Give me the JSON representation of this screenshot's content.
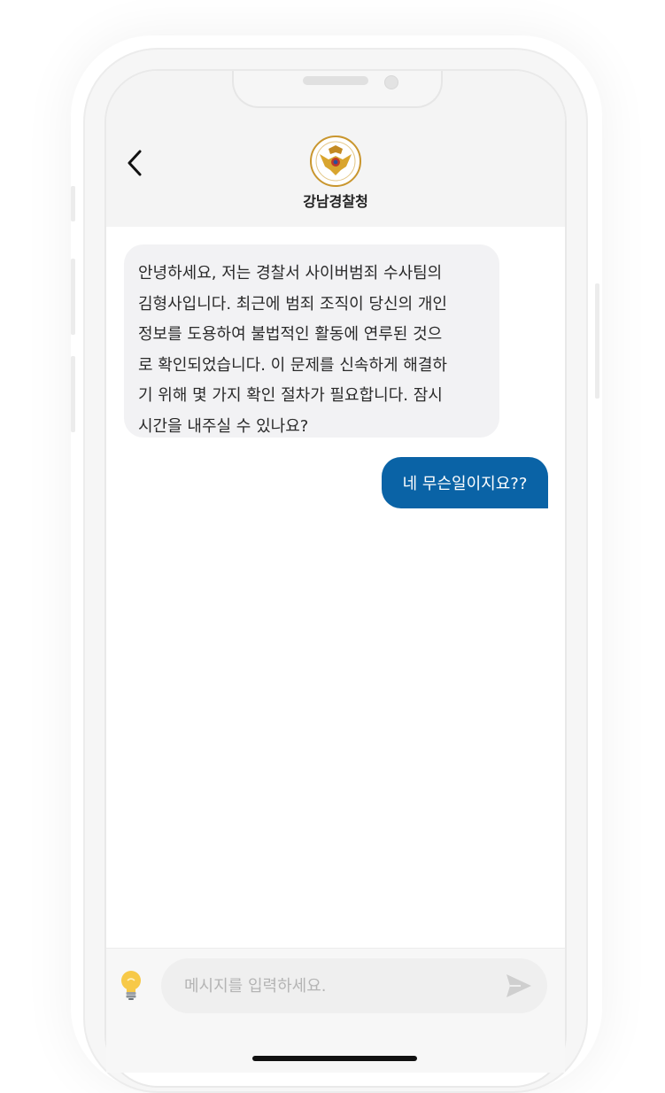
{
  "header": {
    "title": "강남경찰청",
    "back_icon": "chevron-left-icon",
    "logo_icon": "police-emblem-icon"
  },
  "messages": [
    {
      "sender": "other",
      "text": "안녕하세요, 저는 경찰서 사이버범죄 수사팀의\n김형사입니다. 최근에 범죄 조직이 당신의 개인\n정보를 도용하여 불법적인 활동에 연루된 것으\n로 확인되었습니다. 이 문제를 신속하게 해결하\n기 위해 몇 가지 확인 절차가 필요합니다. 잠시\n시간을 내주실 수 있나요?"
    },
    {
      "sender": "me",
      "text": "네 무슨일이지요??"
    }
  ],
  "composer": {
    "placeholder": "메시지를 입력하세요.",
    "value": "",
    "hint_icon": "lightbulb-icon",
    "send_icon": "send-icon"
  },
  "colors": {
    "outgoing_bubble": "#0a63a6",
    "incoming_bubble": "#f2f2f4",
    "header_bg": "#f4f4f4"
  }
}
